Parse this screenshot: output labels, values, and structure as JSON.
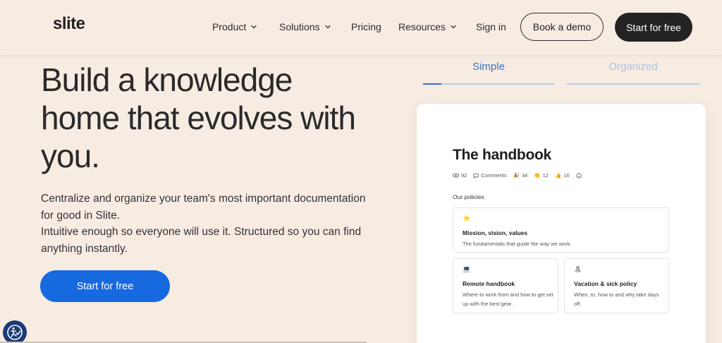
{
  "header": {
    "logo": "slite",
    "nav": [
      {
        "label": "Product",
        "has_dropdown": true
      },
      {
        "label": "Solutions",
        "has_dropdown": true
      },
      {
        "label": "Pricing",
        "has_dropdown": false
      },
      {
        "label": "Resources",
        "has_dropdown": true
      },
      {
        "label": "Sign in",
        "has_dropdown": false
      }
    ],
    "book_demo": "Book a demo",
    "start_free": "Start for free"
  },
  "hero": {
    "title": "Build a knowledge home that evolves with you.",
    "desc_line1": "Centralize and organize your team's most important documentation for good in Slite.",
    "desc_line2": "Intuitive enough so everyone will use it. Structured so you can find anything instantly.",
    "cta": "Start for free"
  },
  "tabs": {
    "items": [
      {
        "label": "Simple",
        "active": true
      },
      {
        "label": "Organized",
        "active": false
      }
    ],
    "active_progress": 0.14
  },
  "doc": {
    "title": "The handbook",
    "meta": {
      "views": "92",
      "comments": "Comments",
      "party": "34",
      "clap": "12",
      "thumbs": "16"
    },
    "section": "Our policies",
    "policies": [
      {
        "icon": "star-emoji",
        "emoji": "⭐",
        "title": "Mission, vision, values",
        "desc": "The fundamentals that guide the way we work."
      },
      {
        "icon": "laptop-emoji",
        "emoji": "💻",
        "title": "Remote handbook",
        "desc": "Where to work from and how to get set up with the best gear."
      },
      {
        "icon": "island-emoji",
        "emoji": "🏝",
        "title": "Vacation & sick policy",
        "desc": "When, to, how to and why take days off."
      }
    ]
  },
  "colors": {
    "background": "#f7ece2",
    "primary_blue": "#1769e0",
    "dark_button": "#232323",
    "tab_active": "#3a73c9",
    "tab_inactive": "#a9c0e2"
  }
}
